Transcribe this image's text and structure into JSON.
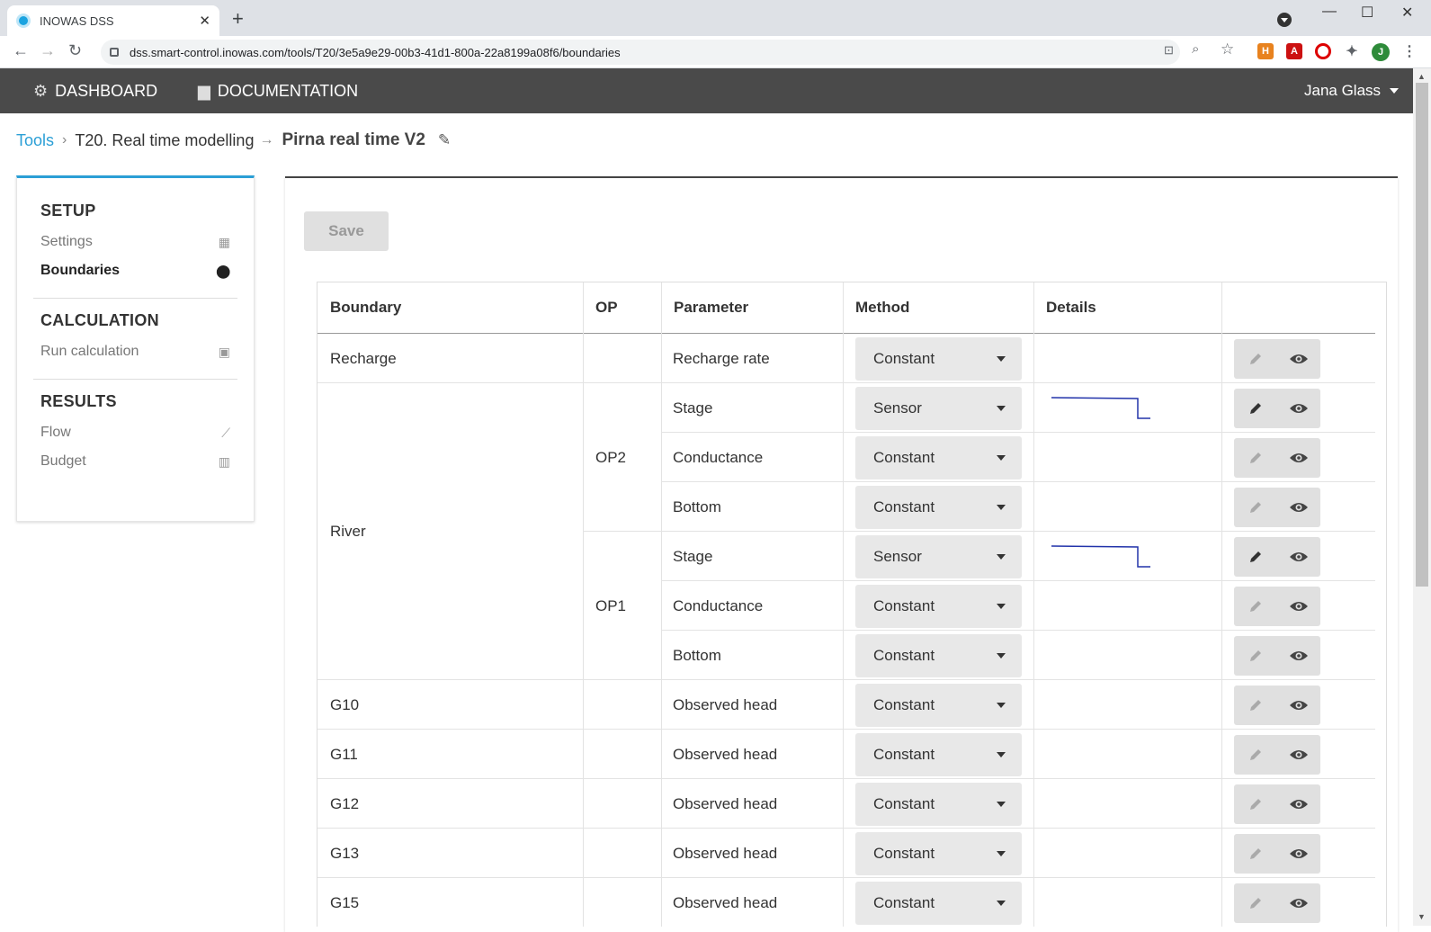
{
  "browser": {
    "tab_title": "INOWAS DSS",
    "url": "dss.smart-control.inowas.com/tools/T20/3e5a9e29-00b3-41d1-800a-22a8199a08f6/boundaries",
    "profile_initial": "J"
  },
  "header": {
    "dashboard_label": "DASHBOARD",
    "documentation_label": "DOCUMENTATION",
    "user_name": "Jana Glass"
  },
  "breadcrumb": {
    "root": "Tools",
    "tool": "T20. Real time modelling",
    "current": "Pirna real time V2"
  },
  "sidebar": {
    "setup_title": "SETUP",
    "setup_items": [
      {
        "label": "Settings",
        "icon": "map-icon"
      },
      {
        "label": "Boundaries",
        "icon": "map-marker-icon"
      }
    ],
    "calc_title": "CALCULATION",
    "calc_items": [
      {
        "label": "Run calculation",
        "icon": "save-icon"
      }
    ],
    "results_title": "RESULTS",
    "results_items": [
      {
        "label": "Flow",
        "icon": "line-chart-icon"
      },
      {
        "label": "Budget",
        "icon": "bar-chart-icon"
      }
    ],
    "active_item": "Boundaries",
    "accent_color": "#2b9fd6"
  },
  "main": {
    "save_label": "Save",
    "table": {
      "headers": [
        "Boundary",
        "OP",
        "Parameter",
        "Method",
        "Details"
      ],
      "groups": [
        {
          "boundary": "Recharge",
          "ops": [
            {
              "op": "",
              "params": [
                {
                  "parameter": "Recharge rate",
                  "method": "Constant",
                  "details": false
                }
              ]
            }
          ]
        },
        {
          "boundary": "River",
          "ops": [
            {
              "op": "OP2",
              "params": [
                {
                  "parameter": "Stage",
                  "method": "Sensor",
                  "details": true
                },
                {
                  "parameter": "Conductance",
                  "method": "Constant",
                  "details": false
                },
                {
                  "parameter": "Bottom",
                  "method": "Constant",
                  "details": false
                }
              ]
            },
            {
              "op": "OP1",
              "params": [
                {
                  "parameter": "Stage",
                  "method": "Sensor",
                  "details": true
                },
                {
                  "parameter": "Conductance",
                  "method": "Constant",
                  "details": false
                },
                {
                  "parameter": "Bottom",
                  "method": "Constant",
                  "details": false
                }
              ]
            }
          ]
        },
        {
          "boundary": "G10",
          "ops": [
            {
              "op": "",
              "params": [
                {
                  "parameter": "Observed head",
                  "method": "Constant",
                  "details": false
                }
              ]
            }
          ]
        },
        {
          "boundary": "G11",
          "ops": [
            {
              "op": "",
              "params": [
                {
                  "parameter": "Observed head",
                  "method": "Constant",
                  "details": false
                }
              ]
            }
          ]
        },
        {
          "boundary": "G12",
          "ops": [
            {
              "op": "",
              "params": [
                {
                  "parameter": "Observed head",
                  "method": "Constant",
                  "details": false
                }
              ]
            }
          ]
        },
        {
          "boundary": "G13",
          "ops": [
            {
              "op": "",
              "params": [
                {
                  "parameter": "Observed head",
                  "method": "Constant",
                  "details": false
                }
              ]
            }
          ]
        },
        {
          "boundary": "G15",
          "ops": [
            {
              "op": "",
              "params": [
                {
                  "parameter": "Observed head",
                  "method": "Constant",
                  "details": false
                }
              ]
            }
          ]
        }
      ]
    },
    "sparkline_color": "#2233aa"
  }
}
